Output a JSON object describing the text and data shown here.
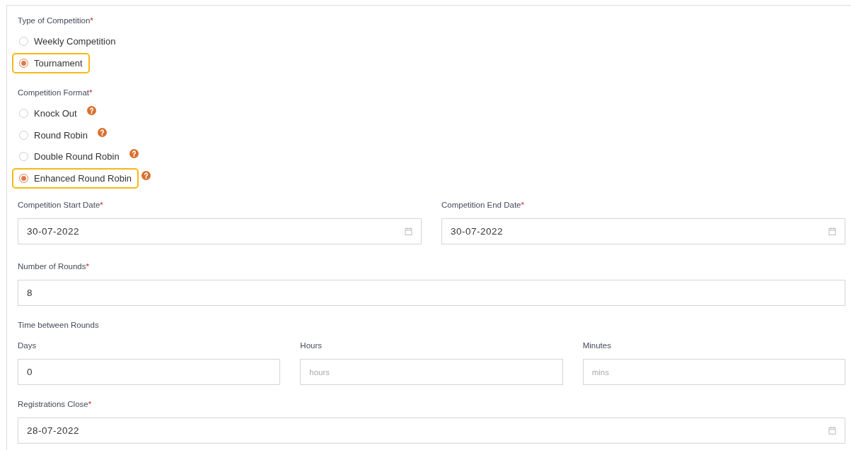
{
  "competition_type": {
    "label": "Type of Competition",
    "required_mark": "*",
    "options": [
      {
        "label": "Weekly Competition",
        "selected": false,
        "help": false
      },
      {
        "label": "Tournament",
        "selected": true,
        "help": false
      }
    ]
  },
  "competition_format": {
    "label": "Competition Format",
    "required_mark": "*",
    "options": [
      {
        "label": "Knock Out",
        "selected": false,
        "help": true
      },
      {
        "label": "Round Robin",
        "selected": false,
        "help": true
      },
      {
        "label": "Double Round Robin",
        "selected": false,
        "help": true
      },
      {
        "label": "Enhanced Round Robin",
        "selected": true,
        "help": true
      }
    ]
  },
  "date_fields": [
    {
      "label": "Competition Start Date",
      "required_mark": "*",
      "value": "30-07-2022",
      "kind": "date"
    },
    {
      "label": "Competition End Date",
      "required_mark": "*",
      "value": "30-07-2022",
      "kind": "date"
    }
  ],
  "rounds": {
    "label": "Number of Rounds",
    "required_mark": "*",
    "value": "8"
  },
  "time_between_rounds": {
    "label": "Time between Rounds",
    "fields": [
      {
        "label": "Days",
        "value": "0"
      },
      {
        "label": "Hours",
        "placeholder": "hours"
      },
      {
        "label": "Minutes",
        "placeholder": "mins"
      }
    ]
  },
  "registrations_close": {
    "label": "Registrations Close",
    "required_mark": "*",
    "value": "28-07-2022",
    "kind": "date"
  }
}
